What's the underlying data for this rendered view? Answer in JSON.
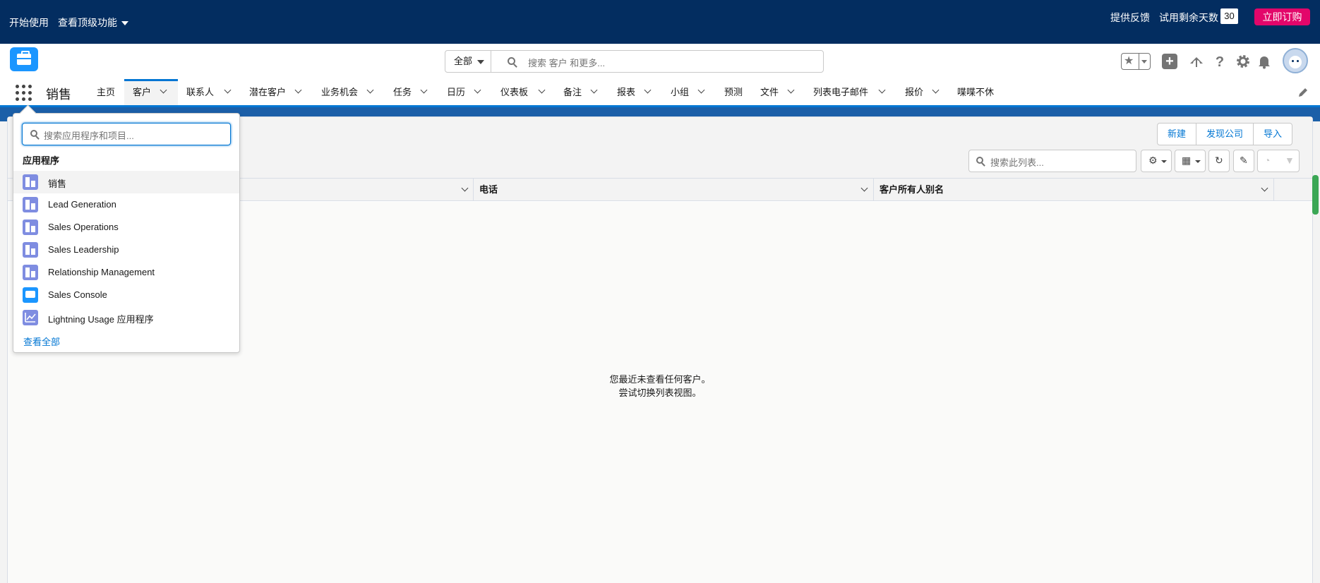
{
  "trial_bar": {
    "get_started": "开始使用",
    "top_features": "查看顶级功能",
    "feedback": "提供反馈",
    "trial_days_label": "试用剩余天数",
    "trial_days": "30",
    "buy_now": "立即订购"
  },
  "header": {
    "search_scope": "全部",
    "search_placeholder": "搜索 客户 和更多..."
  },
  "nav": {
    "app_name": "销售",
    "items": [
      {
        "label": "主页"
      },
      {
        "label": "客户"
      },
      {
        "label": "联系人"
      },
      {
        "label": "潜在客户"
      },
      {
        "label": "业务机会"
      },
      {
        "label": "任务"
      },
      {
        "label": "日历"
      },
      {
        "label": "仪表板"
      },
      {
        "label": "备注"
      },
      {
        "label": "报表"
      },
      {
        "label": "小组"
      },
      {
        "label": "预测"
      },
      {
        "label": "文件"
      },
      {
        "label": "列表电子邮件"
      },
      {
        "label": "报价"
      },
      {
        "label": "喋喋不休"
      }
    ]
  },
  "list_view": {
    "buttons": {
      "new": "新建",
      "discover": "发现公司",
      "import": "导入"
    },
    "search_placeholder": "搜索此列表...",
    "columns": [
      {
        "label": "电话"
      },
      {
        "label": "客户所有人别名"
      }
    ],
    "empty_line1": "您最近未查看任何客户。",
    "empty_line2": "尝试切换列表视图。"
  },
  "launcher": {
    "search_placeholder": "搜索应用程序和项目...",
    "section_title": "应用程序",
    "apps": [
      {
        "label": "销售"
      },
      {
        "label": "Lead Generation"
      },
      {
        "label": "Sales Operations"
      },
      {
        "label": "Sales Leadership"
      },
      {
        "label": "Relationship Management"
      },
      {
        "label": "Sales Console"
      },
      {
        "label": "Lightning Usage 应用程序"
      }
    ],
    "view_all": "查看全部"
  },
  "colors": {
    "brand_navy": "#032d60",
    "brand_blue": "#0176d3",
    "buy_pink": "#e3066a",
    "app_tile": "#7f8de1"
  }
}
